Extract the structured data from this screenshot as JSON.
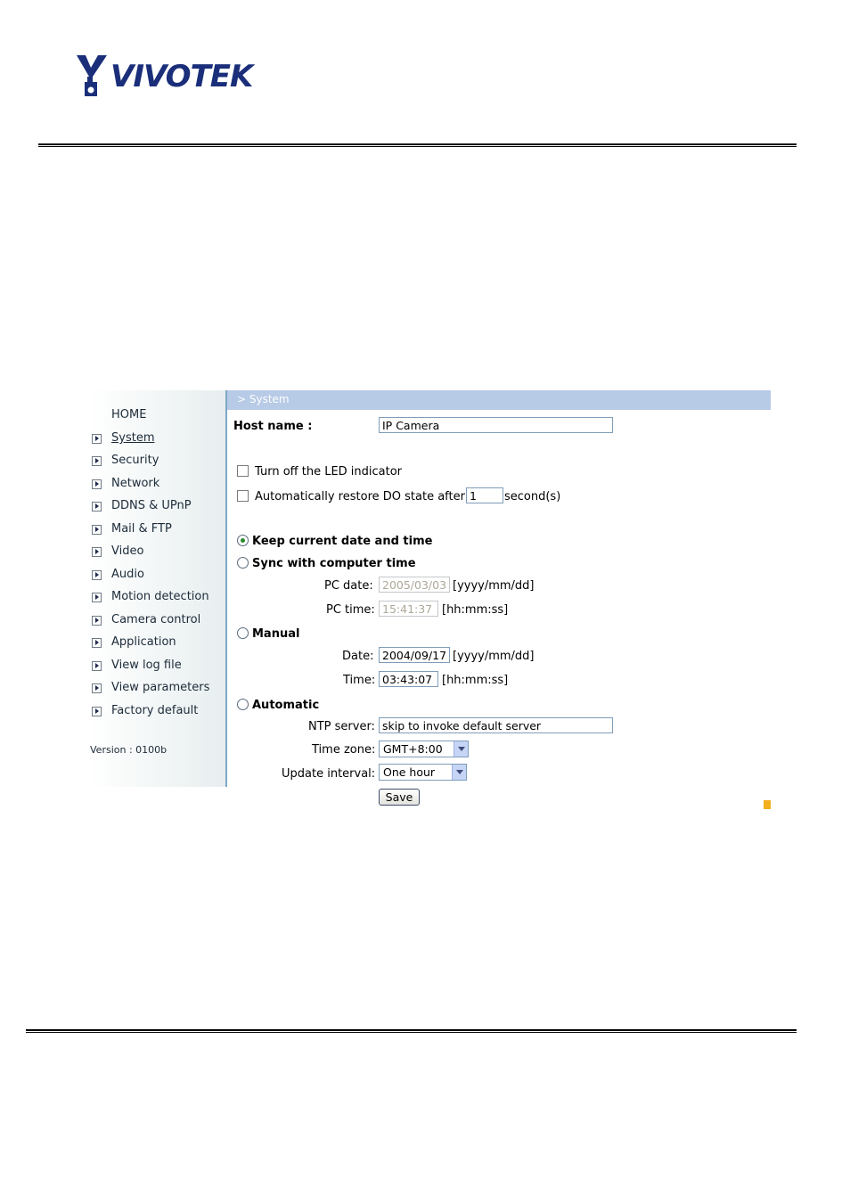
{
  "brand": {
    "logo_text": "VIVOTEK"
  },
  "sidebar": {
    "home": "HOME",
    "items": [
      {
        "label": "System",
        "active": true
      },
      {
        "label": "Security"
      },
      {
        "label": "Network"
      },
      {
        "label": "DDNS & UPnP"
      },
      {
        "label": "Mail & FTP"
      },
      {
        "label": "Video"
      },
      {
        "label": "Audio"
      },
      {
        "label": "Motion detection"
      },
      {
        "label": "Camera control"
      },
      {
        "label": "Application"
      },
      {
        "label": "View log file"
      },
      {
        "label": "View parameters"
      },
      {
        "label": "Factory default"
      }
    ],
    "version": "Version : 0100b"
  },
  "header": {
    "breadcrumb": "> System"
  },
  "form": {
    "host_name_label": "Host name :",
    "host_name_value": "IP Camera",
    "led_label": "Turn off the LED indicator",
    "led_checked": false,
    "restore_do_label": "Automatically restore DO state after",
    "restore_do_value": "1",
    "restore_do_unit": "second(s)",
    "restore_do_checked": false,
    "keep_label": "Keep current date and time",
    "sync_label": "Sync with computer time",
    "pc_date_label": "PC date:",
    "pc_date_value": "2005/03/03",
    "date_format": "[yyyy/mm/dd]",
    "pc_time_label": "PC time:",
    "pc_time_value": "15:41:37",
    "time_format": "[hh:mm:ss]",
    "manual_label": "Manual",
    "date_label": "Date:",
    "date_value": "2004/09/17",
    "time_label": "Time:",
    "time_value": "03:43:07",
    "automatic_label": "Automatic",
    "ntp_label": "NTP server:",
    "ntp_value": "skip to invoke default server",
    "timezone_label": "Time zone:",
    "timezone_value": "GMT+8:00",
    "interval_label": "Update interval:",
    "interval_value": "One hour",
    "save_label": "Save",
    "selected_time_mode": "keep"
  },
  "colors": {
    "header_bar": "#b7cae6",
    "brand": "#1a2e7a",
    "marker": "#f2b01e"
  }
}
